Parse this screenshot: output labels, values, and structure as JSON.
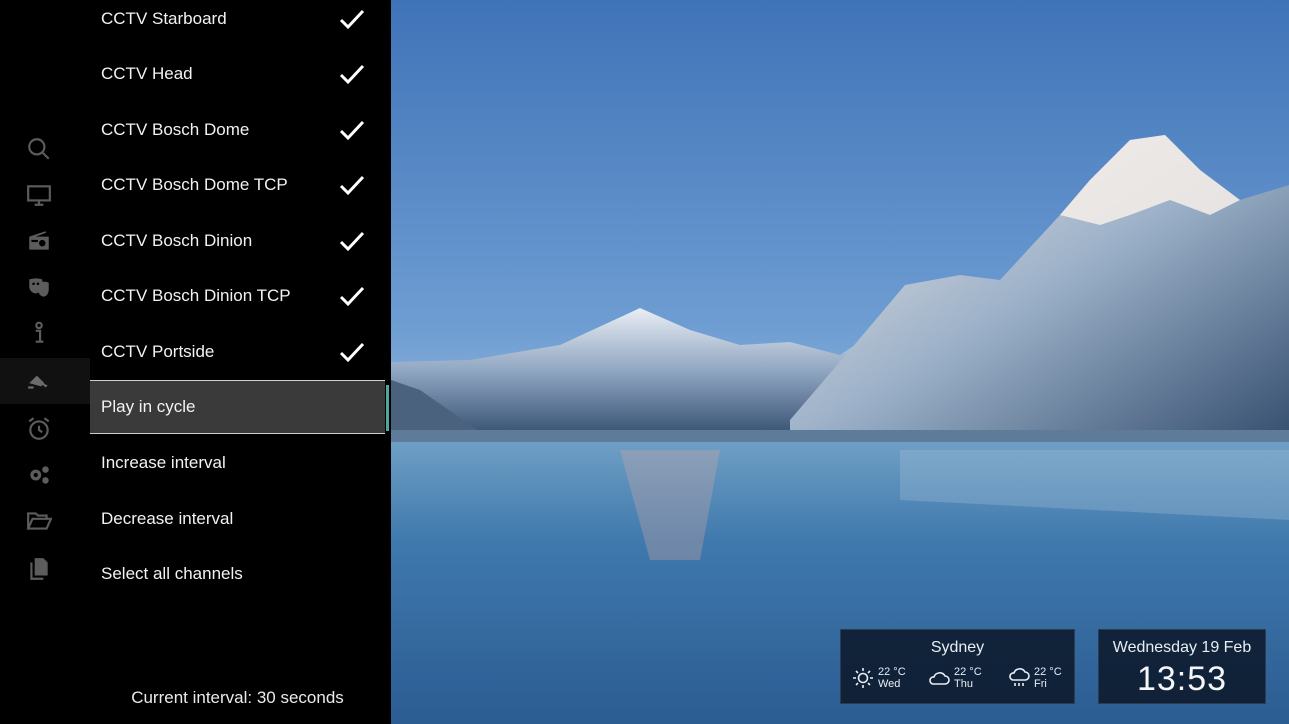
{
  "menu": {
    "channels": [
      {
        "label": "CCTV Starboard",
        "checked": true
      },
      {
        "label": "CCTV Head",
        "checked": true
      },
      {
        "label": "CCTV Bosch Dome",
        "checked": true
      },
      {
        "label": "CCTV Bosch Dome TCP",
        "checked": true
      },
      {
        "label": "CCTV Bosch Dinion",
        "checked": true
      },
      {
        "label": "CCTV Bosch Dinion TCP",
        "checked": true
      },
      {
        "label": "CCTV Portside",
        "checked": true
      }
    ],
    "actions": [
      {
        "label": "Play in cycle",
        "selected": true
      },
      {
        "label": "Increase interval"
      },
      {
        "label": "Decrease interval"
      },
      {
        "label": "Select all channels"
      }
    ],
    "footer": "Current interval: 30 seconds"
  },
  "rail": {
    "icons": [
      "search-icon",
      "tv-icon",
      "radio-icon",
      "theater-masks-icon",
      "info-icon",
      "satellite-dish-icon",
      "alarm-clock-icon",
      "settings-gears-icon",
      "folder-open-icon",
      "copy-icon"
    ],
    "active": "satellite-dish-icon"
  },
  "weather": {
    "city": "Sydney",
    "days": [
      {
        "temp": "22 °C",
        "day": "Wed",
        "icon": "sunny-icon"
      },
      {
        "temp": "22 °C",
        "day": "Thu",
        "icon": "cloudy-icon"
      },
      {
        "temp": "22 °C",
        "day": "Fri",
        "icon": "rain-icon"
      }
    ]
  },
  "clock": {
    "date": "Wednesday 19 Feb",
    "time": "13:53"
  },
  "colors": {
    "accent": "#4aa8a0",
    "panel": "#000000",
    "selected": "#3a3a3a"
  }
}
